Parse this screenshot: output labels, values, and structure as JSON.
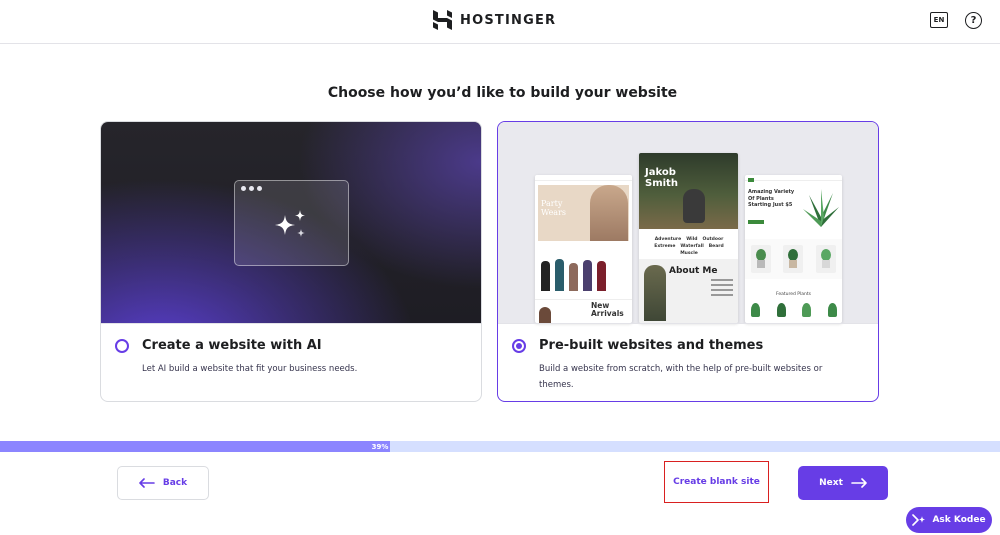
{
  "header": {
    "brand": "HOSTINGER",
    "lang_label": "EN",
    "help_icon": "question-circle-icon",
    "help_symbol": "?"
  },
  "page": {
    "title": "Choose how you’d like to build your website"
  },
  "options": [
    {
      "id": "ai",
      "title": "Create a website with AI",
      "description": "Let AI build a website that fit your business needs.",
      "selected": false
    },
    {
      "id": "prebuilt",
      "title": "Pre-built websites and themes",
      "description": "Build a website from scratch, with the help of pre-built websites or themes.",
      "selected": true
    }
  ],
  "preview": {
    "thumb1_heading": "Party Wears",
    "thumb1_footer": "New Arrivals",
    "thumb2_heading": "Jakob Smith",
    "thumb2_tags": [
      "Adventure",
      "Wild",
      "Outdoor",
      "Extreme",
      "Waterfall",
      "Beard",
      "Muscle"
    ],
    "thumb2_about": "About Me",
    "thumb3_heading": "Amazing Variety Of Plants Starting Just $5",
    "thumb3_section": "Featured Plants"
  },
  "progress": {
    "value": 0.39,
    "label": "39%"
  },
  "footer": {
    "back_label": "Back",
    "blank_label": "Create blank site",
    "next_label": "Next",
    "kodee_label": "Ask Kodee"
  },
  "colors": {
    "accent": "#673de6",
    "progress_fill": "#8c85ff",
    "progress_track": "#d5dfff",
    "highlight_border": "#d92020"
  }
}
